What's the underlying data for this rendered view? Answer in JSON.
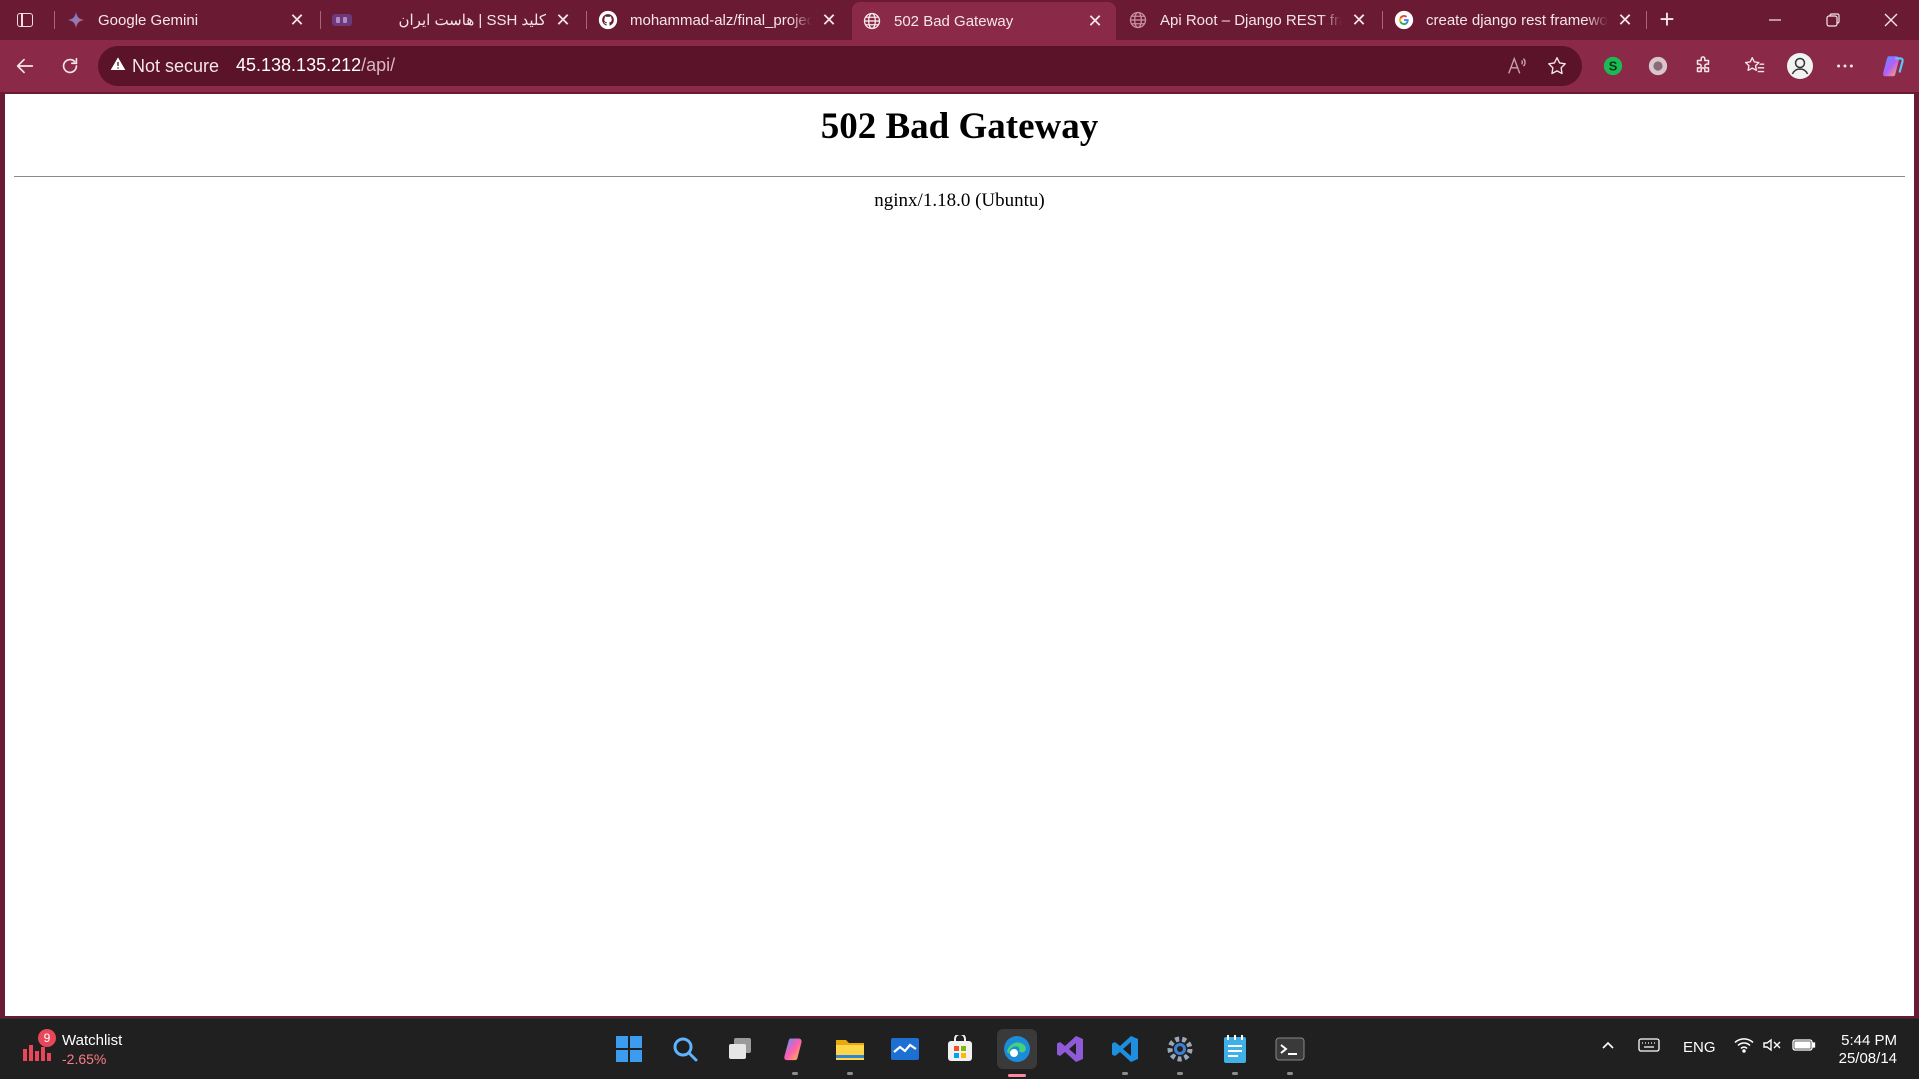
{
  "browser": {
    "tabs": [
      {
        "title": "Google Gemini",
        "icon": "gemini-icon",
        "active": false
      },
      {
        "title": "کلید SSH | هاست ایران",
        "icon": "host-iran-icon",
        "active": false
      },
      {
        "title": "mohammad-alz/final_project",
        "icon": "github-icon",
        "active": false
      },
      {
        "title": "502 Bad Gateway",
        "icon": "globe-icon",
        "active": true
      },
      {
        "title": "Api Root – Django REST framework",
        "icon": "globe-icon",
        "active": false
      },
      {
        "title": "create django rest framework",
        "icon": "google-icon",
        "active": false
      }
    ],
    "address_bar": {
      "security_label": "Not secure",
      "host": "45.138.135.212",
      "path": "/api/"
    },
    "colors": {
      "frame": "#6b1a33",
      "toolbar": "#8a2a48"
    }
  },
  "page": {
    "heading": "502 Bad Gateway",
    "server": "nginx/1.18.0 (Ubuntu)"
  },
  "taskbar": {
    "widget": {
      "title": "Watchlist",
      "change": "-2.65%",
      "badge": "9"
    },
    "apps": [
      "start-icon",
      "search-icon",
      "task-view-icon",
      "copilot-icon",
      "file-explorer-icon",
      "mail-icon",
      "store-icon",
      "edge-icon",
      "visual-studio-icon",
      "vscode-icon",
      "settings-icon",
      "notepad-icon",
      "terminal-icon"
    ],
    "language": "ENG",
    "time": "5:44 PM",
    "date": "25/08/14"
  }
}
